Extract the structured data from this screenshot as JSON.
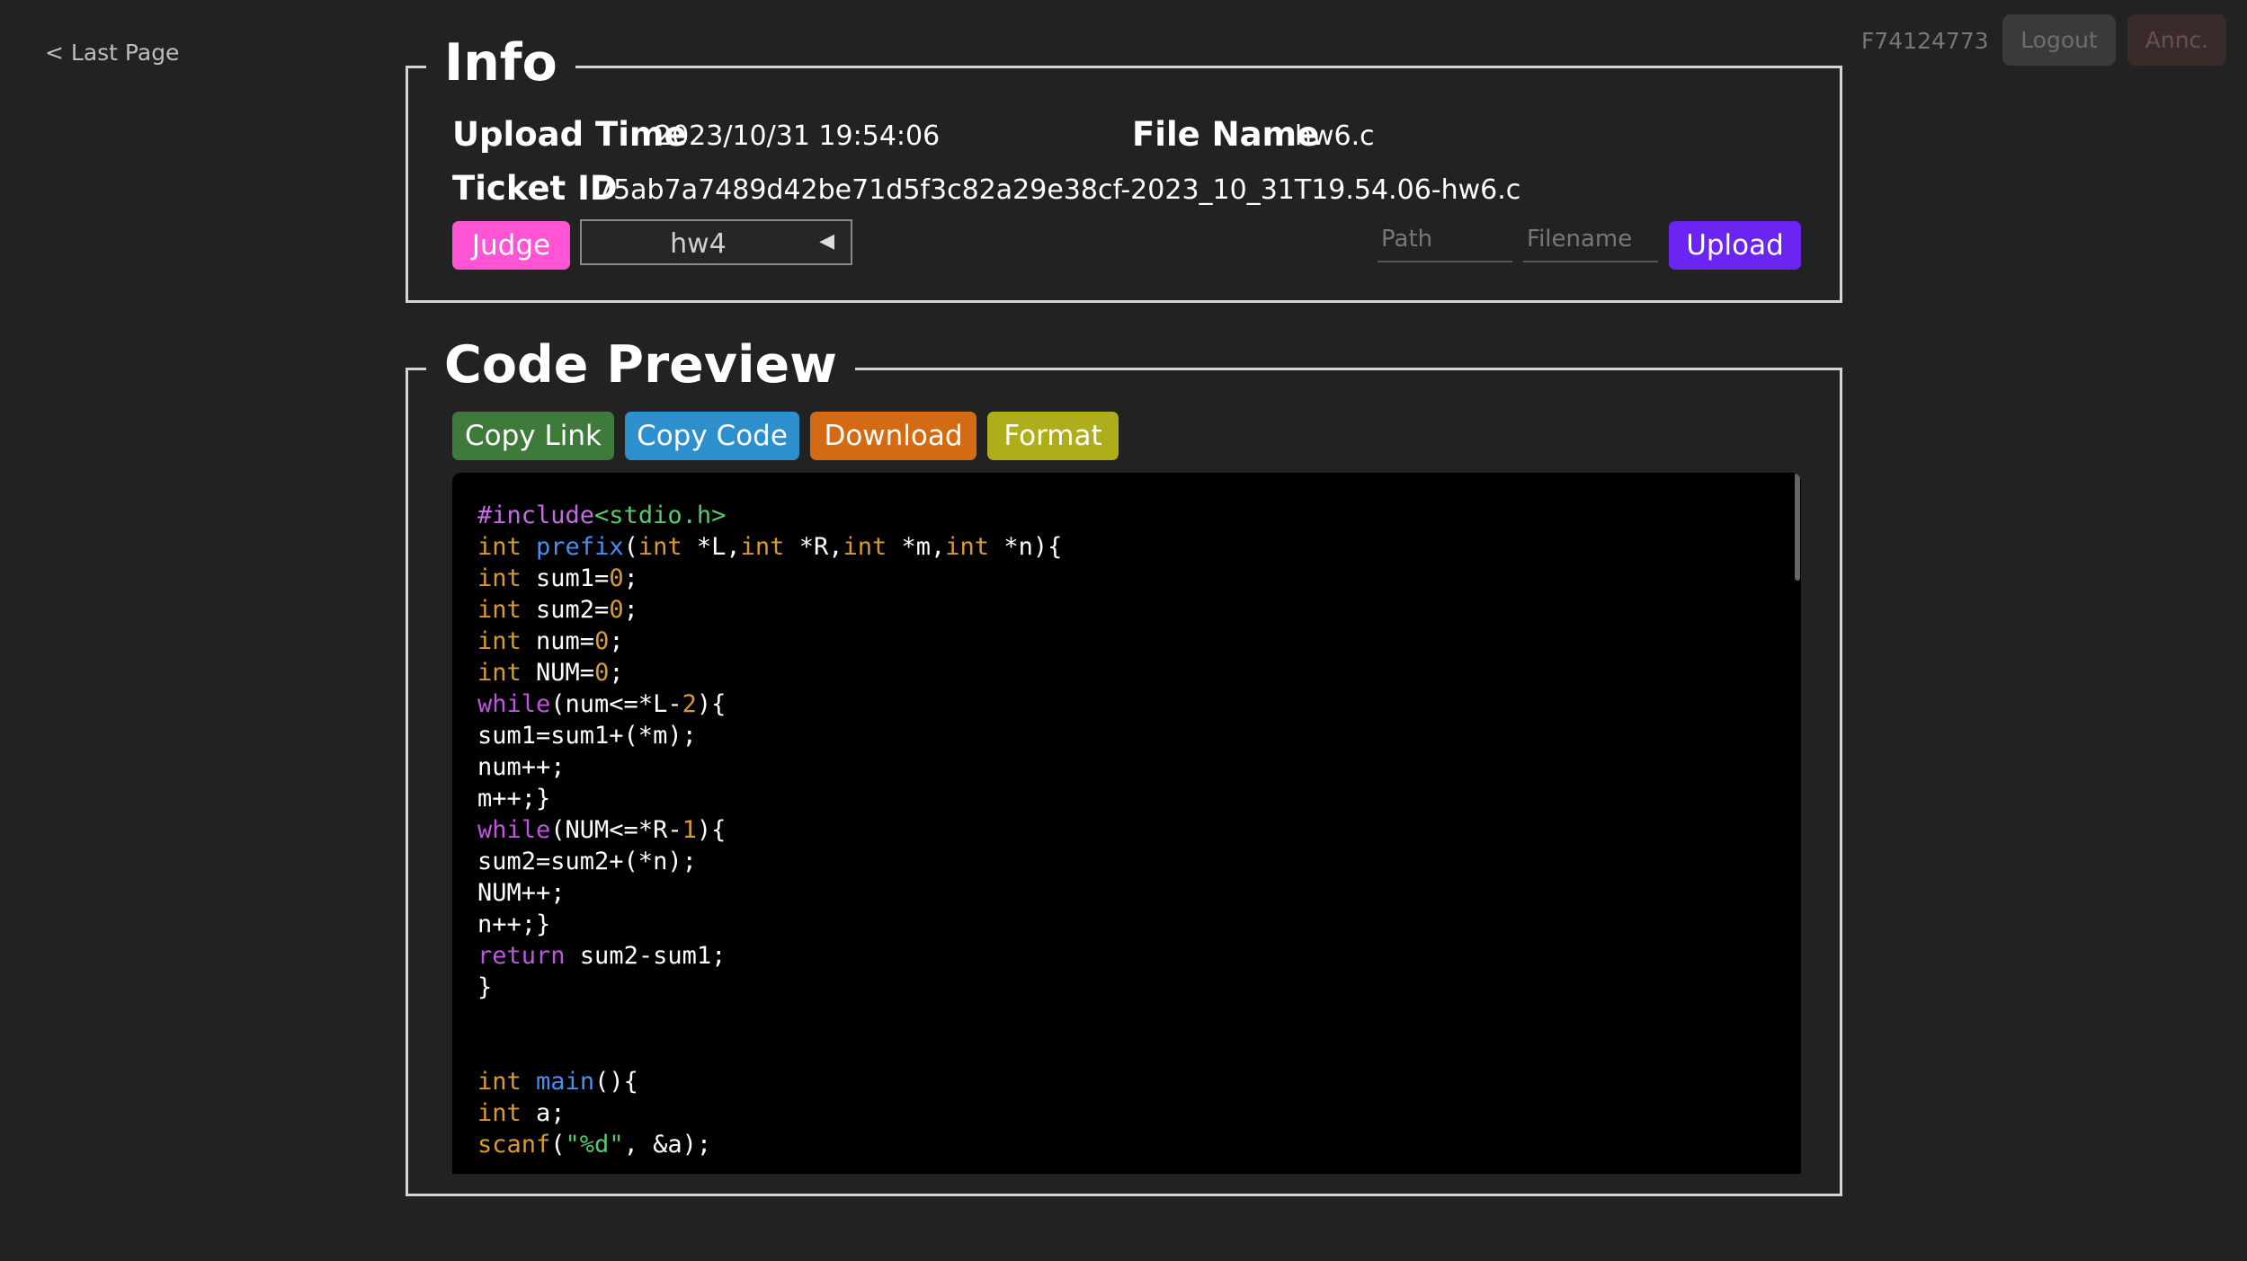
{
  "nav": {
    "last_page": "< Last Page"
  },
  "header": {
    "user_id": "F74124773",
    "logout_label": "Logout",
    "annc_label": "Annc."
  },
  "info": {
    "title": "Info",
    "upload_time_label": "Upload Time",
    "upload_time_value": "2023/10/31 19:54:06",
    "file_name_label": "File Name",
    "file_name_value": "hw6.c",
    "ticket_id_label": "Ticket ID",
    "ticket_id_value": "75ab7a7489d42be71d5f3c82a29e38cf-2023_10_31T19.54.06-hw6.c",
    "judge_label": "Judge",
    "homework_selected": "hw4",
    "path_placeholder": "Path",
    "filename_placeholder": "Filename",
    "upload_label": "Upload"
  },
  "code_preview": {
    "title": "Code Preview",
    "copy_link_label": "Copy Link",
    "copy_code_label": "Copy Code",
    "download_label": "Download",
    "format_label": "Format",
    "colors": {
      "include": "#c56be3",
      "type": "#d99a35",
      "func": "#4a8ef0",
      "keyword": "#c056e0",
      "number": "#d99a35",
      "string": "#56c96b",
      "plain": "#ffffff"
    },
    "lines": [
      [
        [
          "#include",
          "include"
        ],
        [
          "<stdio.h>",
          "string"
        ]
      ],
      [
        [
          "int",
          "type"
        ],
        [
          " ",
          "plain"
        ],
        [
          "prefix",
          "func"
        ],
        [
          "(",
          "plain"
        ],
        [
          "int",
          "type"
        ],
        [
          " *L,",
          "plain"
        ],
        [
          "int",
          "type"
        ],
        [
          " *R,",
          "plain"
        ],
        [
          "int",
          "type"
        ],
        [
          " *m,",
          "plain"
        ],
        [
          "int",
          "type"
        ],
        [
          " *n){",
          "plain"
        ]
      ],
      [
        [
          "int",
          "type"
        ],
        [
          " sum1=",
          "plain"
        ],
        [
          "0",
          "number"
        ],
        [
          ";",
          "plain"
        ]
      ],
      [
        [
          "int",
          "type"
        ],
        [
          " sum2=",
          "plain"
        ],
        [
          "0",
          "number"
        ],
        [
          ";",
          "plain"
        ]
      ],
      [
        [
          "int",
          "type"
        ],
        [
          " num=",
          "plain"
        ],
        [
          "0",
          "number"
        ],
        [
          ";",
          "plain"
        ]
      ],
      [
        [
          "int",
          "type"
        ],
        [
          " NUM=",
          "plain"
        ],
        [
          "0",
          "number"
        ],
        [
          ";",
          "plain"
        ]
      ],
      [
        [
          "while",
          "keyword"
        ],
        [
          "(num<=*L-",
          "plain"
        ],
        [
          "2",
          "number"
        ],
        [
          "){",
          "plain"
        ]
      ],
      [
        [
          "sum1=sum1+(*m);",
          "plain"
        ]
      ],
      [
        [
          "num++;",
          "plain"
        ]
      ],
      [
        [
          "m++;}",
          "plain"
        ]
      ],
      [
        [
          "while",
          "keyword"
        ],
        [
          "(NUM<=*R-",
          "plain"
        ],
        [
          "1",
          "number"
        ],
        [
          "){",
          "plain"
        ]
      ],
      [
        [
          "sum2=sum2+(*n);",
          "plain"
        ]
      ],
      [
        [
          "NUM++;",
          "plain"
        ]
      ],
      [
        [
          "n++;}",
          "plain"
        ]
      ],
      [
        [
          "return",
          "keyword"
        ],
        [
          " sum2-sum1;",
          "plain"
        ]
      ],
      [
        [
          "}",
          "plain"
        ]
      ],
      [],
      [],
      [
        [
          "int",
          "type"
        ],
        [
          " ",
          "plain"
        ],
        [
          "main",
          "func"
        ],
        [
          "(){",
          "plain"
        ]
      ],
      [
        [
          "int",
          "type"
        ],
        [
          " a;",
          "plain"
        ]
      ],
      [
        [
          "scanf",
          "type"
        ],
        [
          "(",
          "plain"
        ],
        [
          "\"%d\"",
          "string"
        ],
        [
          ", &a);",
          "plain"
        ]
      ]
    ]
  }
}
